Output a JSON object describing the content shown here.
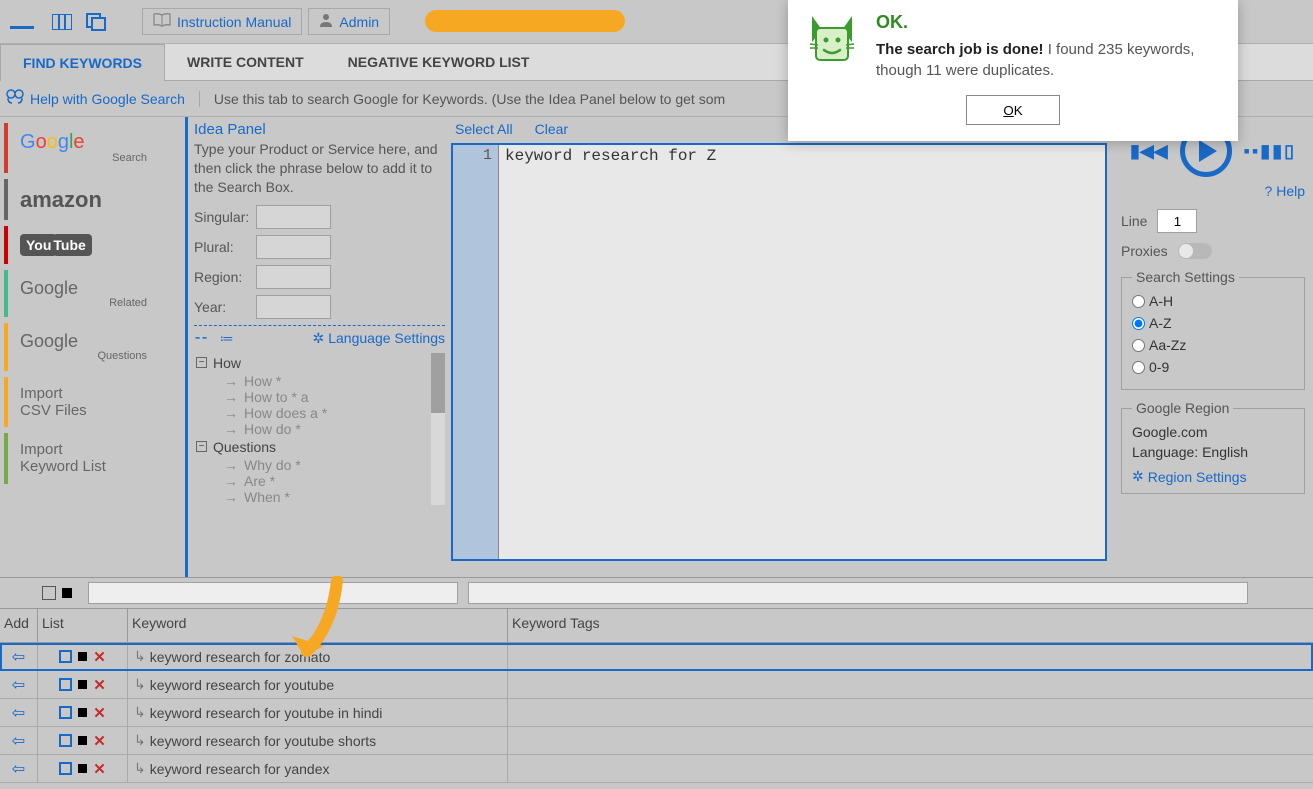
{
  "toolbar": {
    "manual": "Instruction Manual",
    "admin": "Admin"
  },
  "tabs": {
    "find": "FIND KEYWORDS",
    "write": "WRITE CONTENT",
    "negative": "NEGATIVE KEYWORD LIST"
  },
  "helpbar": {
    "link": "Help with Google Search",
    "desc": "Use this tab to search Google for Keywords. (Use the Idea Panel below to get som"
  },
  "sidebar": {
    "google_sub": "Search",
    "amazon": "amazon",
    "youtube1": "You",
    "youtube2": "Tube",
    "grelated_sub": "Related",
    "gquestions_sub": "Questions",
    "import1a": "Import",
    "import1b": "CSV Files",
    "import2a": "Import",
    "import2b": "Keyword List"
  },
  "idea": {
    "title": "Idea Panel",
    "desc": "Type your Product or Service here, and then click the phrase below to add it to the Search Box.",
    "singular": "Singular:",
    "plural": "Plural:",
    "region": "Region:",
    "year": "Year:",
    "lang": "Language Settings",
    "how": "How",
    "how1": "How *",
    "how2": "How to * a",
    "how3": "How does a  *",
    "how4": "How do  *",
    "questions": "Questions",
    "q1": "Why do  *",
    "q2": "Are  *",
    "q3": "When  *"
  },
  "editor": {
    "select_all": "Select All",
    "clear": "Clear",
    "line_num": "1",
    "code": "keyword research for Z"
  },
  "right": {
    "help": "Help",
    "line_label": "Line",
    "line_value": "1",
    "proxies": "Proxies",
    "search_settings": "Search Settings",
    "ah": "A-H",
    "az": "A-Z",
    "aazz": "Aa-Zz",
    "n09": "0-9",
    "region_title": "Google Region",
    "region_domain": "Google.com",
    "region_lang": "Language: English",
    "region_link": "Region Settings"
  },
  "results": {
    "h_add": "Add",
    "h_list": "List",
    "h_kw": "Keyword",
    "h_tags": "Keyword Tags",
    "rows": [
      "keyword research for zomato",
      "keyword research for youtube",
      "keyword research for youtube in hindi",
      "keyword research for youtube shorts",
      "keyword research for yandex"
    ]
  },
  "notif": {
    "title": "OK.",
    "strong": "The search job is done!",
    "rest": " I found 235 keywords, though 11 were duplicates.",
    "ok": "K"
  }
}
